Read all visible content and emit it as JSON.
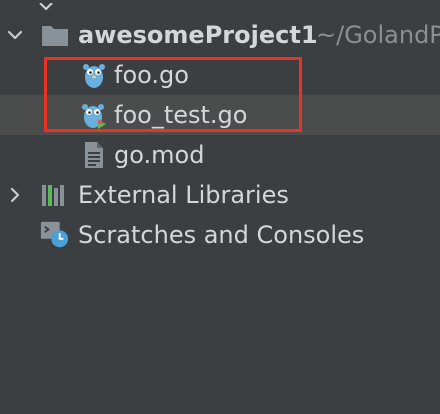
{
  "tree": {
    "root": {
      "name": "awesomeProject1",
      "path": "~/GolandP",
      "icon": "folder-icon"
    },
    "files": [
      {
        "name": "foo.go",
        "icon": "gopher-icon"
      },
      {
        "name": "foo_test.go",
        "icon": "gopher-test-icon"
      },
      {
        "name": "go.mod",
        "icon": "file-text-icon"
      }
    ],
    "external_libraries": {
      "label": "External Libraries",
      "icon": "libraries-icon"
    },
    "scratches": {
      "label": "Scratches and Consoles",
      "icon": "scratches-icon"
    }
  },
  "colors": {
    "background": "#3c3f41",
    "text": "#d4d7da",
    "muted": "#8c8f91",
    "highlight": "#ea3323",
    "folder": "#8a9299",
    "gopher": "#6ab0de"
  }
}
